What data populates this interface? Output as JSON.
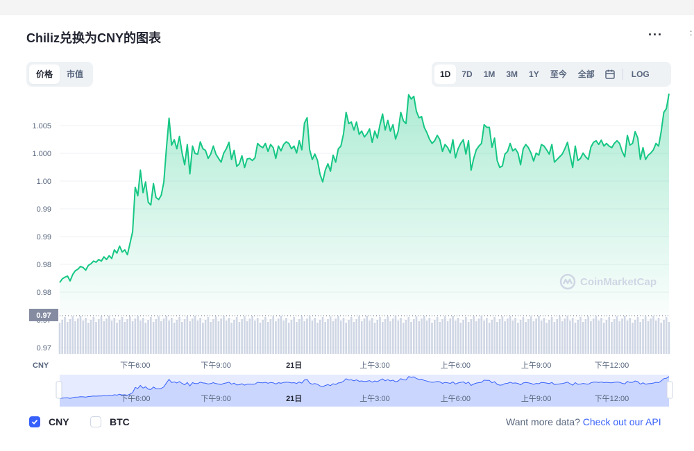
{
  "title": "Chiliz兑换为CNY的图表",
  "tabs_left": [
    "价格",
    "市值"
  ],
  "active_left": 0,
  "ranges": [
    "1D",
    "7D",
    "1M",
    "3M",
    "1Y",
    "至今",
    "全部"
  ],
  "active_range": 0,
  "log_label": "LOG",
  "watermark": "CoinMarketCap",
  "currency_label": "CNY",
  "legend": [
    {
      "label": "CNY",
      "checked": true
    },
    {
      "label": "BTC",
      "checked": false
    }
  ],
  "api_text": "Want more data?",
  "api_link": "Check out our API",
  "colors": {
    "line": "#16c784",
    "nav_line": "#3861fb",
    "accent": "#3861fb"
  },
  "chart_data": {
    "type": "line",
    "y_ticks": [
      "1.005",
      "1.000",
      "1.00",
      "0.99",
      "0.99",
      "0.98",
      "0.98",
      "0.97",
      "0.97"
    ],
    "y_range": [
      0.9668,
      1.0057
    ],
    "current_price_label": "0.97",
    "x_ticks": [
      "下午6:00",
      "下午9:00",
      "21日",
      "上午3:00",
      "上午6:00",
      "上午9:00",
      "下午12:00"
    ],
    "has_volume_bars": true,
    "grid": true,
    "values": [
      0.973,
      0.9737,
      0.974,
      0.9742,
      0.9733,
      0.9745,
      0.9752,
      0.9755,
      0.976,
      0.9758,
      0.9753,
      0.9762,
      0.9765,
      0.977,
      0.9768,
      0.9773,
      0.977,
      0.9778,
      0.9773,
      0.978,
      0.9775,
      0.9791,
      0.9785,
      0.9798,
      0.9787,
      0.9791,
      0.9782,
      0.9803,
      0.9825,
      0.9908,
      0.9892,
      0.994,
      0.9898,
      0.9918,
      0.988,
      0.9875,
      0.9915,
      0.9889,
      0.9885,
      0.9893,
      0.9918,
      0.9981,
      1.0037,
      0.9987,
      0.9997,
      0.998,
      1.0003,
      0.9972,
      0.995,
      0.9988,
      0.9933,
      0.9985,
      0.9971,
      0.997,
      0.9993,
      0.998,
      0.9977,
      0.9962,
      0.997,
      0.9985,
      0.997,
      0.9962,
      0.9955,
      0.9972,
      0.998,
      0.9992,
      0.996,
      0.9977,
      0.9947,
      0.9952,
      0.9967,
      0.9945,
      0.9961,
      0.9962,
      0.9958,
      0.9963,
      0.999,
      0.9985,
      0.9982,
      0.999,
      0.9975,
      0.9988,
      0.9982,
      0.9962,
      0.9985,
      0.9976,
      0.9988,
      0.9993,
      0.999,
      0.998,
      0.9985,
      0.9972,
      0.9995,
      0.9978,
      1.0028,
      1.0038,
      0.9978,
      0.996,
      0.997,
      0.9958,
      0.9932,
      0.9918,
      0.994,
      0.9952,
      0.9938,
      0.9968,
      0.9955,
      0.998,
      0.9985,
      1.0008,
      1.0048,
      1.0027,
      1.003,
      1.0015,
      1.003,
      1.0007,
      1.0013,
      1.0002,
      1.0008,
      1.0017,
      0.9992,
      1.0013,
      1.0,
      1.0025,
      1.0045,
      1.0015,
      1.0033,
      1.0013,
      1.0025,
      0.9998,
      1.0013,
      1.0048,
      1.0032,
      1.0027,
      1.0081,
      1.0073,
      1.0078,
      1.005,
      1.0038,
      1.004,
      1.002,
      1.001,
      0.9998,
      0.999,
      0.9995,
      1.0005,
      0.9997,
      0.9975,
      0.9988,
      0.9982,
      0.9972,
      0.9997,
      0.9963,
      0.998,
      0.999,
      0.9997,
      0.997,
      0.9995,
      0.994,
      0.9962,
      0.9978,
      0.9985,
      0.999,
      1.0025,
      1.002,
      1.002,
      0.9983,
      1.0,
      0.9958,
      0.9945,
      0.9948,
      0.997,
      0.9975,
      0.999,
      0.9976,
      0.998,
      0.9972,
      0.995,
      0.998,
      0.9988,
      0.9982,
      0.9972,
      0.9957,
      0.9972,
      0.9968,
      0.9988,
      0.9985,
      0.9978,
      0.997,
      0.9988,
      0.9955,
      0.996,
      0.9965,
      0.997,
      0.998,
      0.9992,
      0.9968,
      0.9945,
      0.9985,
      0.9958,
      0.9962,
      0.9972,
      0.9965,
      0.996,
      0.9983,
      0.9992,
      0.9995,
      0.9988,
      0.9996,
      0.9985,
      0.999,
      0.9985,
      0.9982,
      0.999,
      0.9995,
      0.999,
      0.9975,
      0.9965,
      1.0005,
      0.9987,
      0.999,
      1.0012,
      1.0,
      0.996,
      0.9982,
      0.996,
      0.9968,
      0.9972,
      0.9978,
      0.999,
      0.9985,
      1.0012,
      1.0048,
      1.0055,
      1.0083
    ],
    "x_tick_index": [
      29,
      60,
      90,
      121,
      152,
      183,
      212
    ]
  }
}
